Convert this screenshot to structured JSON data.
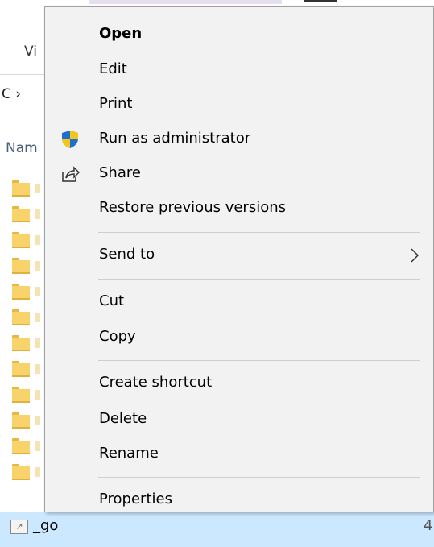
{
  "explorer": {
    "ribbon_tab_partial": "Vi",
    "address_partial": "C ›",
    "column_header_partial": "Nam",
    "selected_file": {
      "name": "_go",
      "size_partial": "4"
    }
  },
  "context_menu": {
    "items": [
      {
        "label": "Open",
        "bold": true
      },
      {
        "label": "Edit"
      },
      {
        "label": "Print"
      },
      {
        "label": "Run as administrator",
        "icon": "uac-shield-icon"
      },
      {
        "label": "Share",
        "icon": "share-icon"
      },
      {
        "label": "Restore previous versions"
      },
      {
        "label": "Send to",
        "submenu": true
      },
      {
        "label": "Cut"
      },
      {
        "label": "Copy"
      },
      {
        "label": "Create shortcut"
      },
      {
        "label": "Delete"
      },
      {
        "label": "Rename"
      },
      {
        "label": "Properties"
      }
    ]
  },
  "colors": {
    "menu_background": "#f2f2f2",
    "menu_border": "#a0a0a0",
    "separator": "#cfcfcf",
    "selection": "#cce8ff",
    "folder_yellow": "#f8d26a",
    "shield_blue": "#1f6fd1",
    "shield_yellow": "#f5c518"
  }
}
